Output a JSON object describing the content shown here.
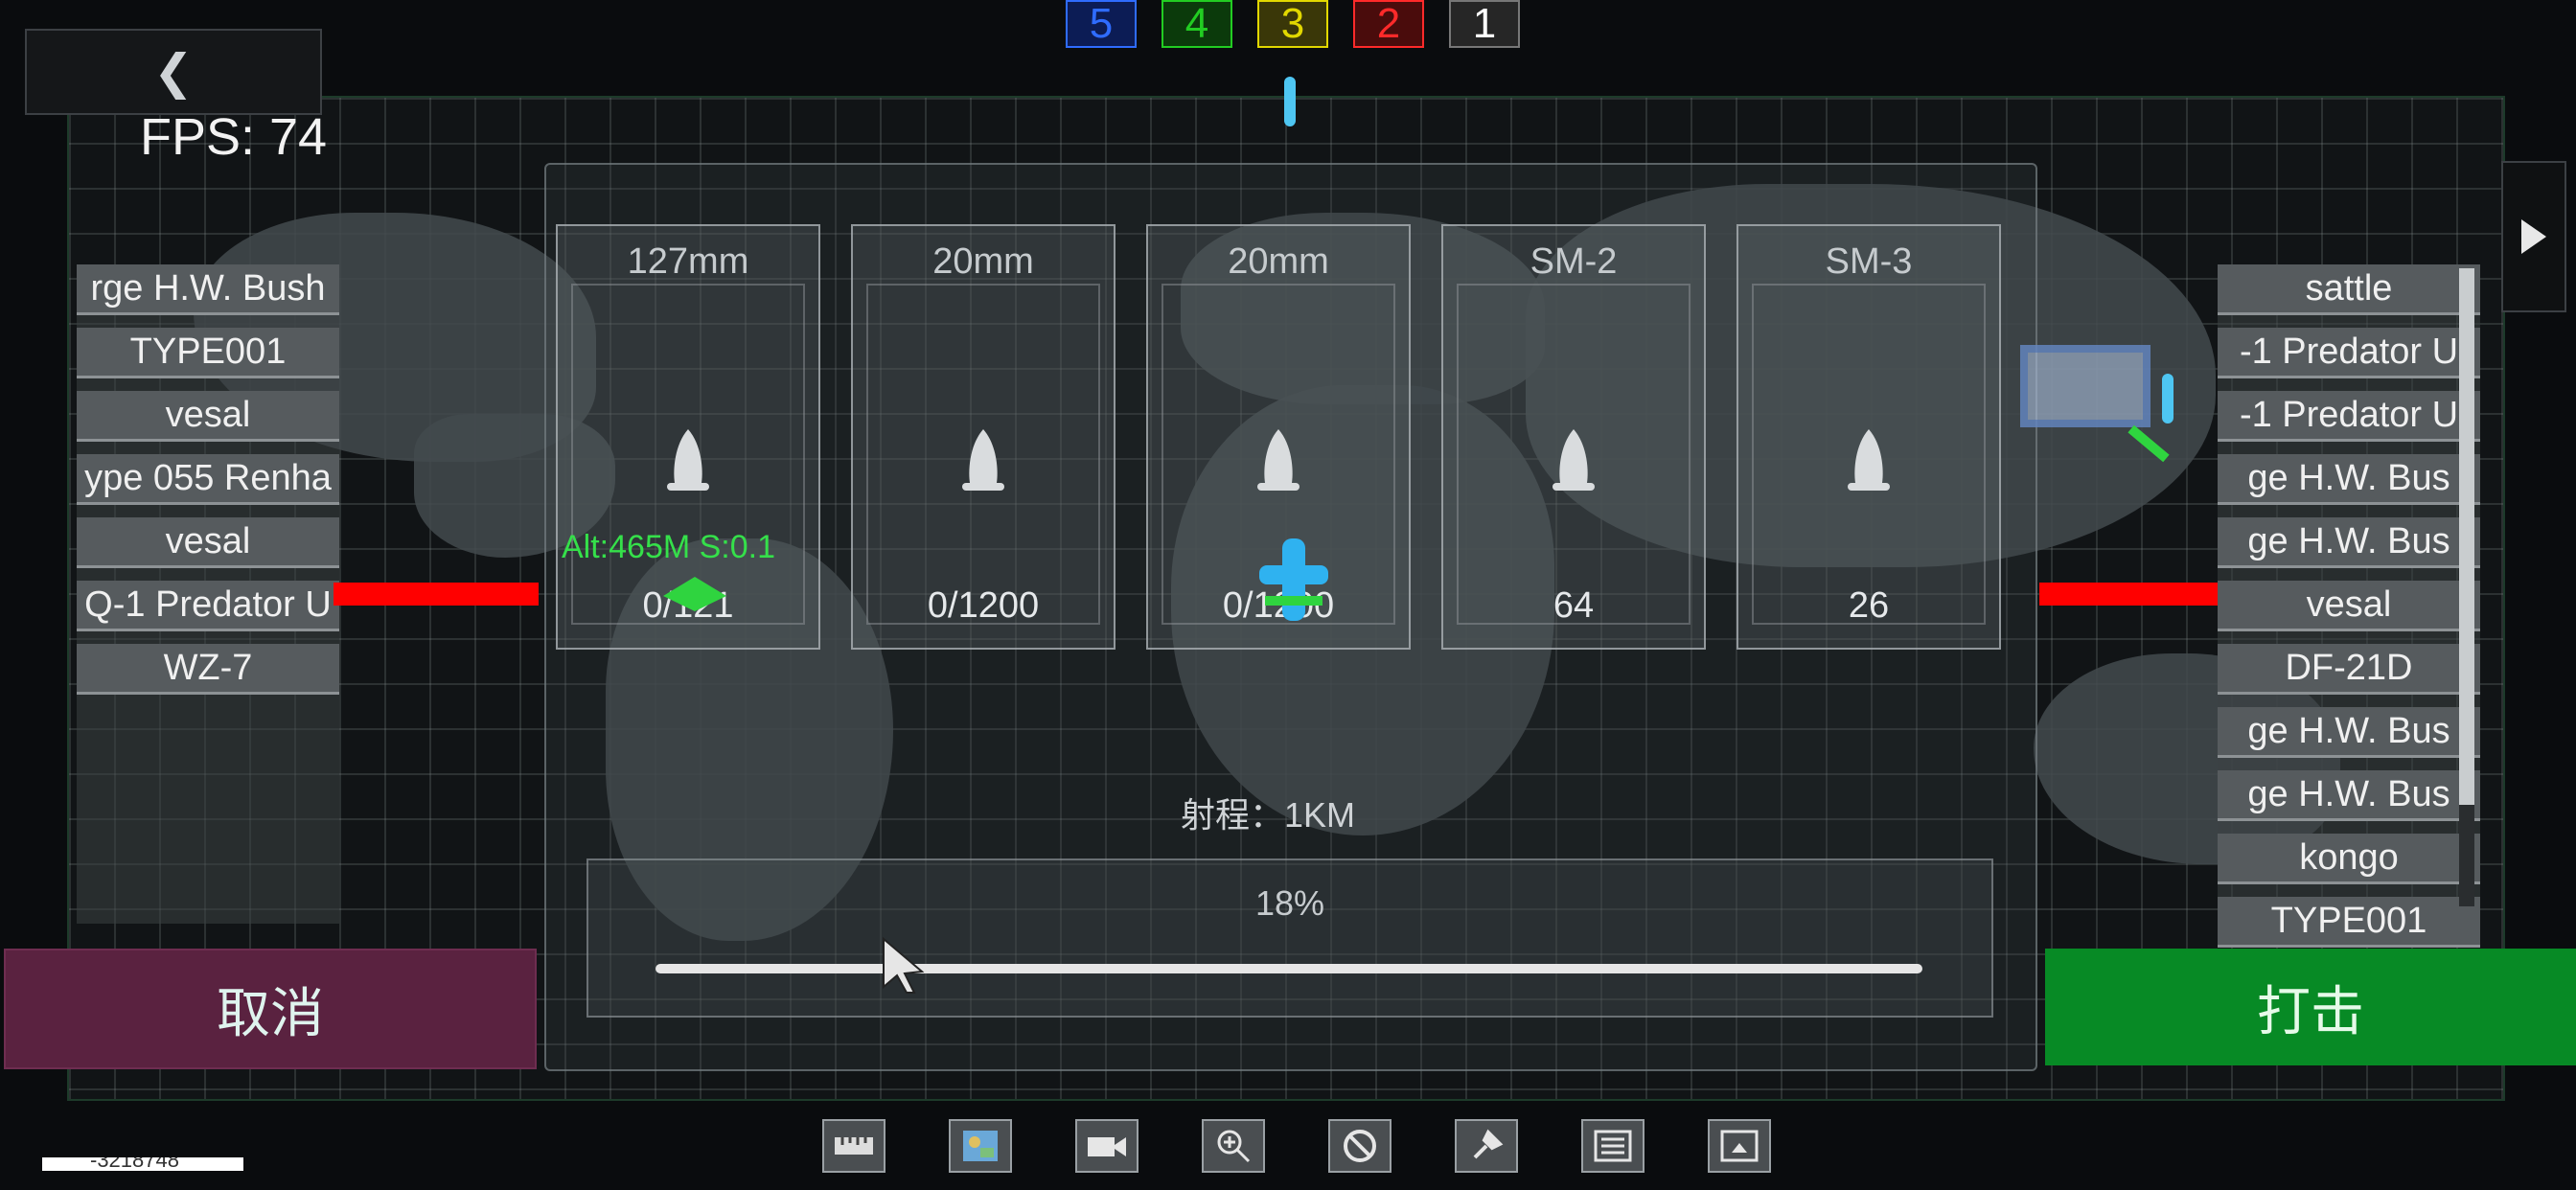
{
  "hud": {
    "fps_label": "FPS: 74",
    "coordinate_readout": "-3218748"
  },
  "squads": [
    {
      "label": "5",
      "color": "#2f6cff"
    },
    {
      "label": "4",
      "color": "#22cc22"
    },
    {
      "label": "3",
      "color": "#e2d800"
    },
    {
      "label": "2",
      "color": "#ff2a2a"
    },
    {
      "label": "1",
      "color": "#ffffff"
    }
  ],
  "left_list": {
    "items": [
      "rge H.W. Bush",
      "TYPE001",
      "vesal",
      "ype 055 Renha",
      "vesal",
      "Q-1 Predator U",
      "WZ-7"
    ]
  },
  "right_list": {
    "items": [
      "sattle",
      "-1 Predator U",
      "-1 Predator U",
      "ge H.W. Bus",
      "ge H.W. Bus",
      "vesal",
      "DF-21D",
      "ge H.W. Bus",
      "ge H.W. Bus",
      "kongo",
      "TYPE001"
    ]
  },
  "weapons": [
    {
      "name": "127mm",
      "ammo": "0/121"
    },
    {
      "name": "20mm",
      "ammo": "0/1200"
    },
    {
      "name": "20mm",
      "ammo": "0/1200"
    },
    {
      "name": "SM-2",
      "ammo": "64"
    },
    {
      "name": "SM-3",
      "ammo": "26"
    }
  ],
  "unit_status": {
    "altitude_speed": "Alt:465M S:0.1"
  },
  "range": {
    "label": "射程：",
    "value": "1KM"
  },
  "slider": {
    "percent_label": "18%",
    "value": 0.18
  },
  "buttons": {
    "cancel": "取消",
    "strike": "打击"
  },
  "toolbar": {
    "tools": [
      "ruler-icon",
      "map-icon",
      "camera-icon",
      "zoom-in-icon",
      "block-icon",
      "pin-icon",
      "list-icon",
      "screen-icon"
    ]
  },
  "colors": {
    "cancel_bg": "#5a2240",
    "strike_bg": "#078a25",
    "target_line": "#ff0000"
  }
}
